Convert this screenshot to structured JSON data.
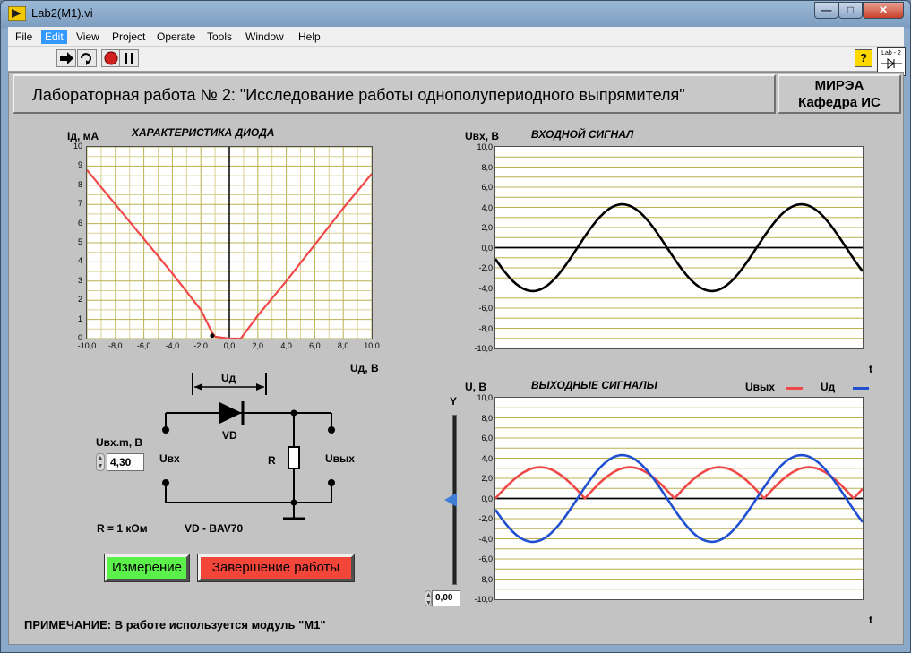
{
  "window": {
    "title": "Lab2(M1).vi",
    "min_label": "—",
    "max_label": "□",
    "close_label": "✕"
  },
  "menu": [
    "File",
    "Edit",
    "View",
    "Project",
    "Operate",
    "Tools",
    "Window",
    "Help"
  ],
  "toolbar": {
    "help_label": "?",
    "lab_icon_label": "Lab - 2"
  },
  "header": {
    "title": "Лабораторная работа № 2: \"Исследование работы однополупериодного выпрямителя\"",
    "org_line1": "МИРЭА",
    "org_line2": "Кафедра ИС"
  },
  "diode_chart": {
    "title": "ХАРАКТЕРИСТИКА ДИОДА",
    "ylabel": "Iд, мА",
    "xlabel": "Uд, В",
    "yticks": [
      "10",
      "9",
      "8",
      "7",
      "6",
      "5",
      "4",
      "3",
      "2",
      "1",
      "0"
    ],
    "xticks": [
      "-10,0",
      "-8,0",
      "-6,0",
      "-4,0",
      "-2,0",
      "0,0",
      "2,0",
      "4,0",
      "6,0",
      "8,0",
      "10,0"
    ]
  },
  "input_chart": {
    "title": "ВХОДНОЙ СИГНАЛ",
    "ylabel": "Uвх, В",
    "xlabel": "t",
    "yticks": [
      "10,0",
      "8,0",
      "6,0",
      "4,0",
      "2,0",
      "0,0",
      "-2,0",
      "-4,0",
      "-6,0",
      "-8,0",
      "-10,0"
    ]
  },
  "output_chart": {
    "title": "ВЫХОДНЫЕ СИГНАЛЫ",
    "ylabel": "U, В",
    "xlabel": "t",
    "legend_out": "Uвых",
    "legend_diode": "Uд",
    "color_out": "#f04848",
    "color_diode": "#2050d0",
    "yticks": [
      "10,0",
      "8,0",
      "6,0",
      "4,0",
      "2,0",
      "0,0",
      "-2,0",
      "-4,0",
      "-6,0",
      "-8,0",
      "-10,0"
    ]
  },
  "circuit": {
    "ud_label": "Uд",
    "vd_label": "VD",
    "r_label": "R",
    "uin_label": "Uвх",
    "uout_label": "Uвых",
    "r_value": "R = 1 кОм",
    "vd_type": "VD - BAV70"
  },
  "amplitude": {
    "label": "Uвх.m, В",
    "value": "4,30"
  },
  "slider": {
    "label": "Y",
    "value": "0,00"
  },
  "buttons": {
    "measure": "Измерение",
    "finish": "Завершение работы"
  },
  "note": "ПРИМЕЧАНИЕ: В работе используется модуль \"М1\"",
  "chart_data": [
    {
      "type": "line",
      "title": "ХАРАКТЕРИСТИКА ДИОДА",
      "xlabel": "Uд, В",
      "ylabel": "Iд, мА",
      "xlim": [
        -10,
        10
      ],
      "ylim": [
        0,
        10
      ],
      "grid": true,
      "series": [
        {
          "color": "#f04848",
          "x": [
            -10,
            -8,
            -6,
            -4,
            -2,
            -1.2,
            -1,
            0,
            0.8,
            1,
            2,
            4,
            6,
            8,
            10
          ],
          "y": [
            8.8,
            7.0,
            5.2,
            3.4,
            1.5,
            0.3,
            0.1,
            0,
            0,
            0.2,
            1.2,
            3.0,
            4.9,
            6.8,
            8.6
          ]
        }
      ],
      "points": [
        {
          "x": -1.2,
          "y": 0.15
        }
      ]
    },
    {
      "type": "line",
      "title": "ВХОДНОЙ СИГНАЛ",
      "xlabel": "t",
      "ylabel": "Uвх, В",
      "ylim": [
        -10,
        10
      ],
      "grid": true,
      "series": [
        {
          "color": "#000000",
          "amplitude": 4.3,
          "periods": 2.05,
          "phase_deg": 195
        }
      ]
    },
    {
      "type": "line",
      "title": "ВЫХОДНЫЕ СИГНАЛЫ",
      "xlabel": "t",
      "ylabel": "U, В",
      "ylim": [
        -10,
        10
      ],
      "grid": true,
      "legend": "top-right",
      "series": [
        {
          "name": "Uвых",
          "color": "#f04848",
          "amplitude": 3.1,
          "periods": 4.1,
          "phase_deg": 0,
          "rectified": true
        },
        {
          "name": "Uд",
          "color": "#2050d0",
          "amplitude": 4.3,
          "periods": 2.05,
          "phase_deg": 195
        }
      ]
    }
  ]
}
